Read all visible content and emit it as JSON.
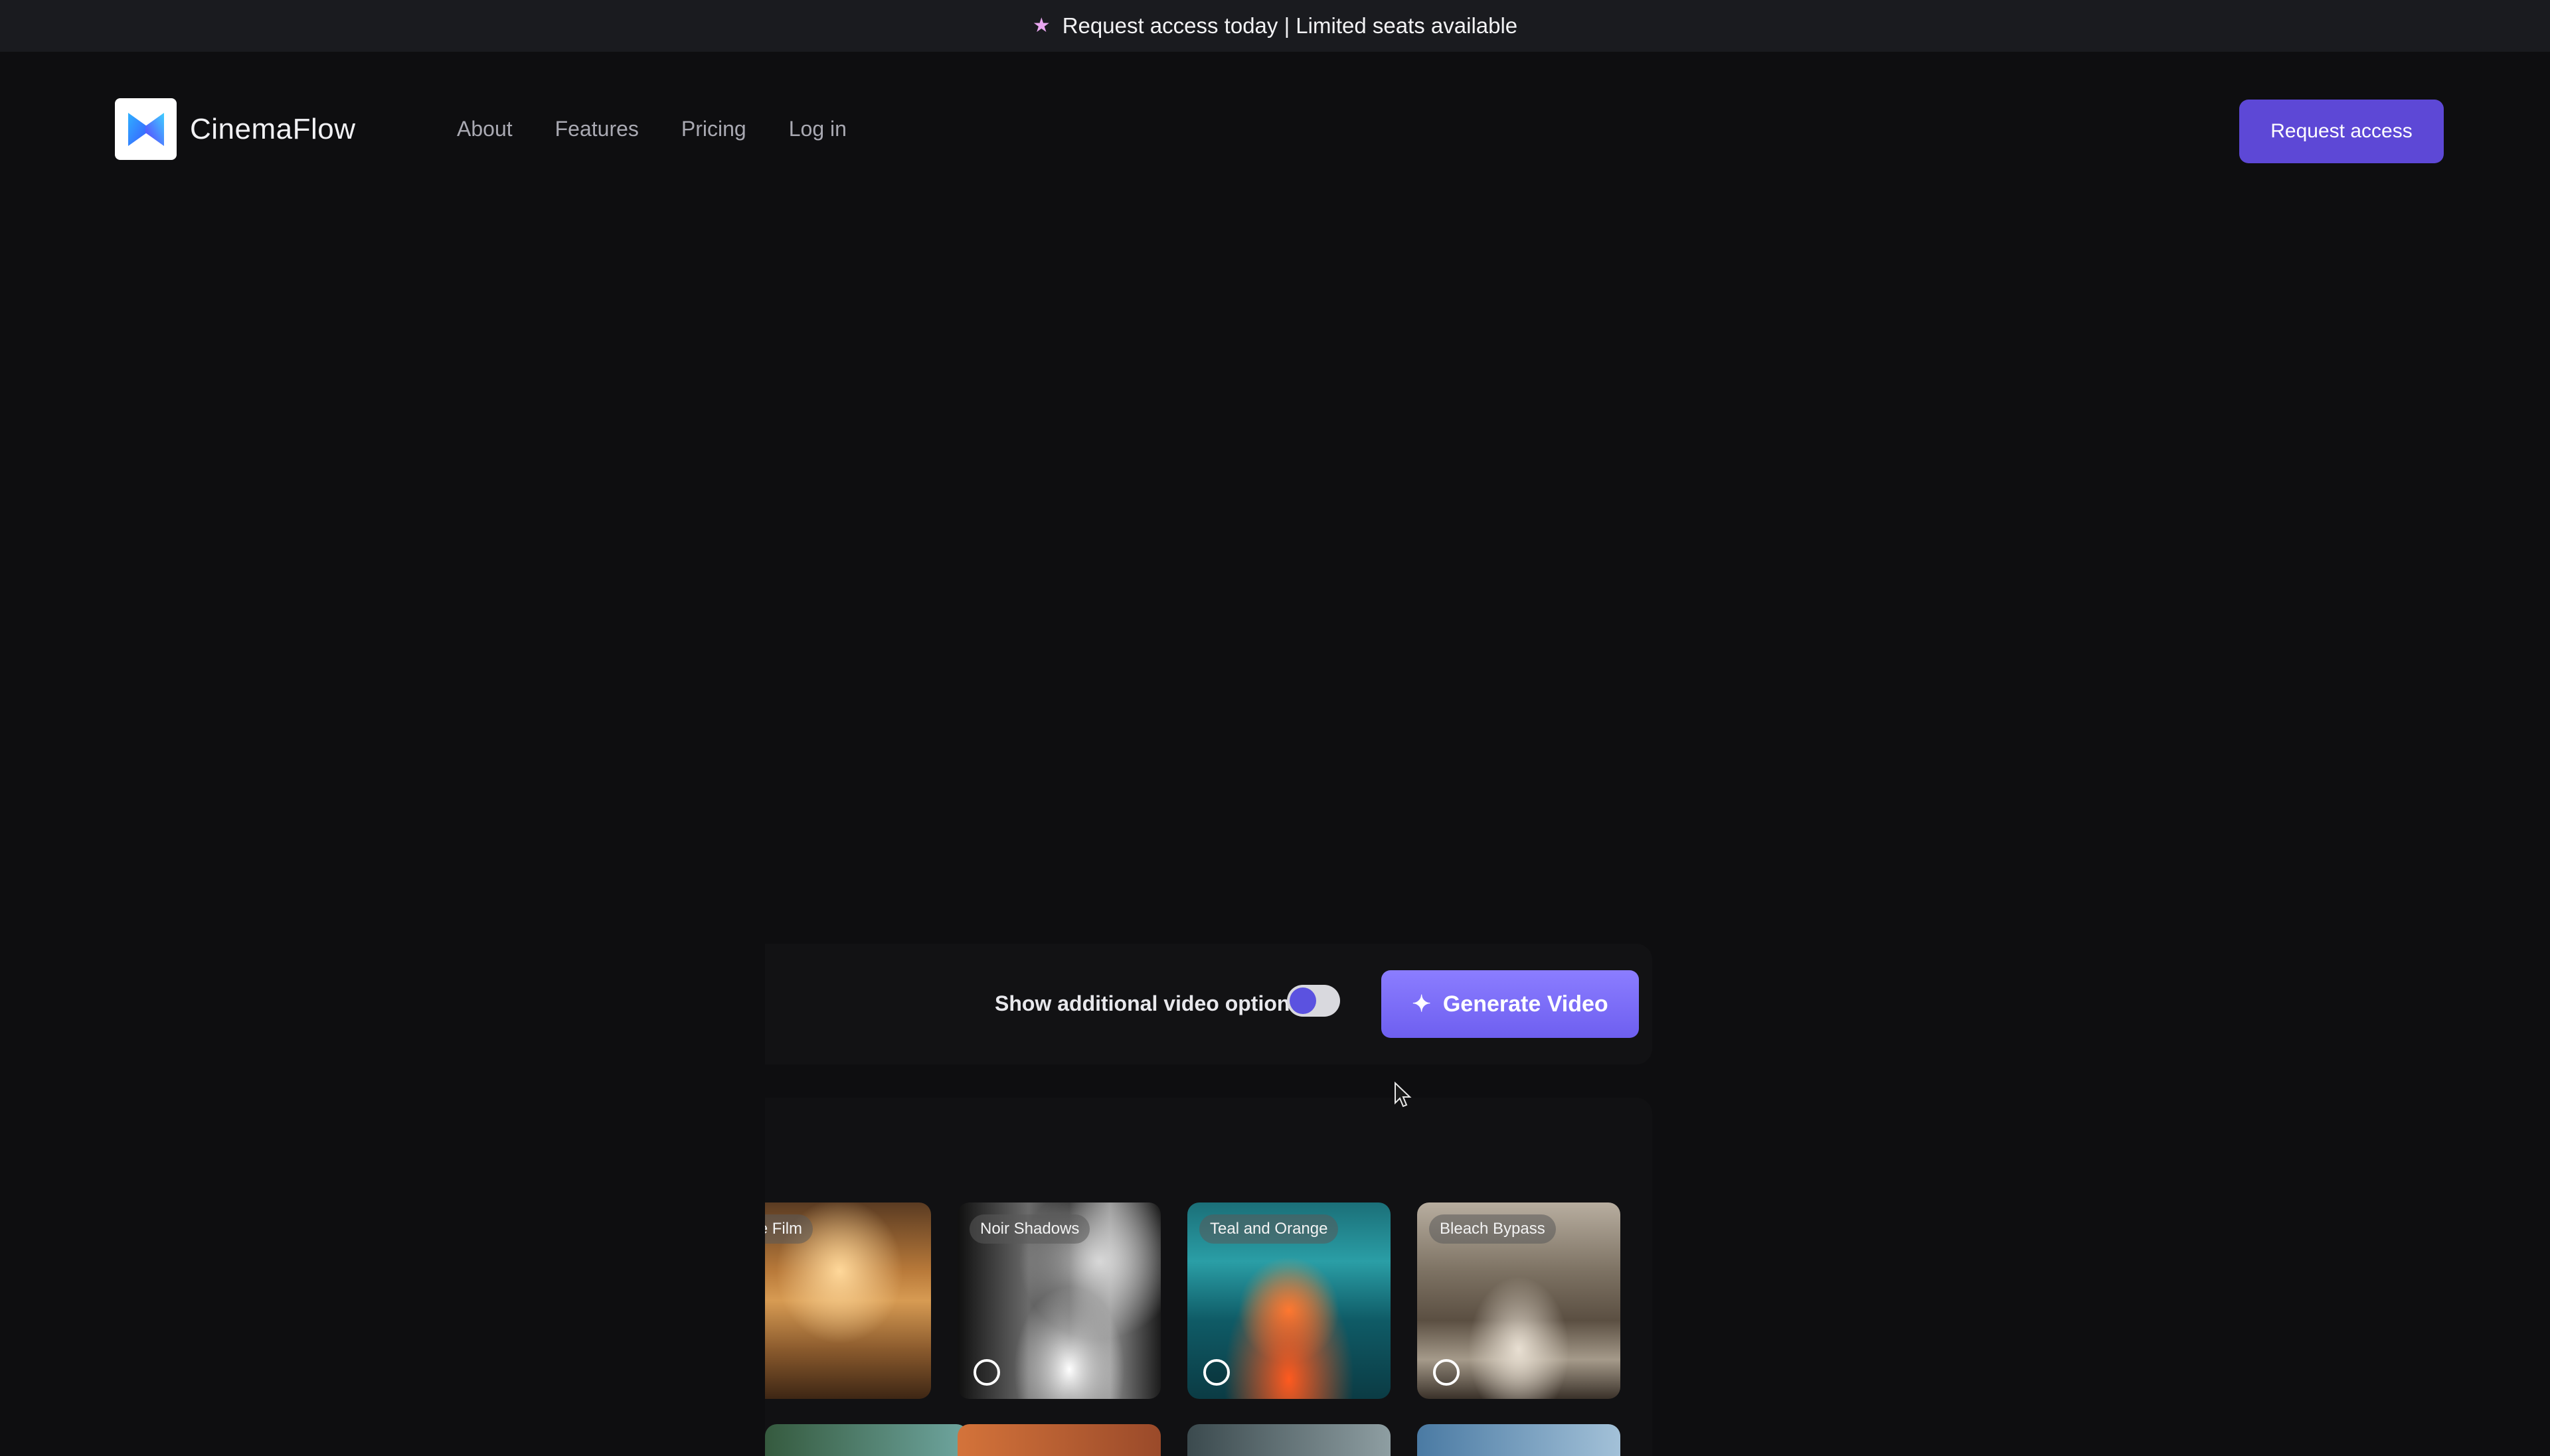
{
  "announcement": {
    "icon": "star-icon",
    "text": "Request access today | Limited seats available",
    "icon_color": "#e8a7f0"
  },
  "header": {
    "brand": "CinemaFlow",
    "nav": [
      {
        "label": "About"
      },
      {
        "label": "Features"
      },
      {
        "label": "Pricing"
      },
      {
        "label": "Log in"
      }
    ],
    "cta_label": "Request access",
    "cta_color": "#5d48d6"
  },
  "options": {
    "toggle_label": "Show additional video options",
    "toggle_on": true,
    "generate_label": "Generate Video",
    "generate_icon": "sparkle-icon"
  },
  "styles": {
    "cards": [
      {
        "label": "Vintage Film",
        "visible_label": "ntage Film",
        "selected": false
      },
      {
        "label": "Noir Shadows",
        "visible_label": "Noir Shadows",
        "selected": false
      },
      {
        "label": "Teal and Orange",
        "visible_label": "Teal and Orange",
        "selected": false
      },
      {
        "label": "Bleach Bypass",
        "visible_label": "Bleach Bypass",
        "selected": false
      }
    ]
  },
  "colors": {
    "background": "#0e0e10",
    "announcement_bg": "#1a1b1f",
    "accent": "#6e5ff0"
  }
}
